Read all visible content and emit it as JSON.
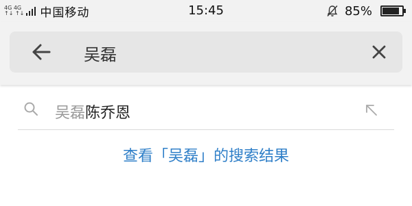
{
  "status_bar": {
    "network_top": "4G 4G",
    "network_bottom": "↑↓ ↑↓",
    "carrier": "中国移动",
    "time": "15:45",
    "battery_percent": "85%",
    "battery_level": 0.85,
    "icons": [
      "signal-icon",
      "alarm-off-icon",
      "battery-icon"
    ]
  },
  "search": {
    "query": "吴磊",
    "icons": [
      "back-arrow-icon",
      "clear-icon"
    ]
  },
  "suggestions": [
    {
      "match": "吴磊",
      "rest": "陈乔恩"
    }
  ],
  "view_results_label": "查看「吴磊」的搜索结果",
  "colors": {
    "status_bg": "#f2f2f2",
    "search_box_bg": "#e6e6e6",
    "link": "#2f7fc8",
    "match_text": "#9a9a9a"
  }
}
